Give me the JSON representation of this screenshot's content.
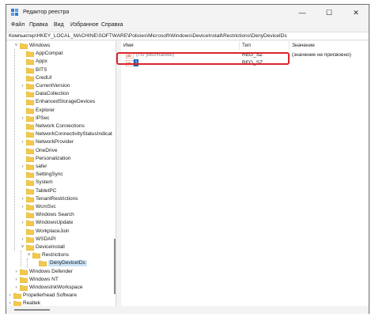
{
  "window": {
    "title": "Редактор реестра",
    "controls": {
      "minimize": "—",
      "maximize": "☐",
      "close": "✕"
    }
  },
  "menu": [
    "Файл",
    "Правка",
    "Вид",
    "Избранное",
    "Справка"
  ],
  "address": "Компьютер\\HKEY_LOCAL_MACHINE\\SOFTWARE\\Policies\\Microsoft\\Windows\\DeviceInstall\\Restrictions\\DenyDeviceIDs",
  "tree": [
    {
      "label": "Windows",
      "level": 1,
      "expander": "˅",
      "open": true
    },
    {
      "label": "AppCompat",
      "level": 2
    },
    {
      "label": "Appx",
      "level": 2
    },
    {
      "label": "BITS",
      "level": 2
    },
    {
      "label": "CredUI",
      "level": 2
    },
    {
      "label": "CurrentVersion",
      "level": 2,
      "expander": "›"
    },
    {
      "label": "DataCollection",
      "level": 2
    },
    {
      "label": "EnhancedStorageDevices",
      "level": 2
    },
    {
      "label": "Explorer",
      "level": 2
    },
    {
      "label": "IPSec",
      "level": 2,
      "expander": "›"
    },
    {
      "label": "Network Connections",
      "level": 2
    },
    {
      "label": "NetworkConnectivityStatusIndicat",
      "level": 2
    },
    {
      "label": "NetworkProvider",
      "level": 2,
      "expander": "›"
    },
    {
      "label": "OneDrive",
      "level": 2
    },
    {
      "label": "Personalization",
      "level": 2
    },
    {
      "label": "safer",
      "level": 2,
      "expander": "›"
    },
    {
      "label": "SettingSync",
      "level": 2
    },
    {
      "label": "System",
      "level": 2
    },
    {
      "label": "TabletPC",
      "level": 2
    },
    {
      "label": "TenantRestrictions",
      "level": 2,
      "expander": "›"
    },
    {
      "label": "WcmSvc",
      "level": 2,
      "expander": "›"
    },
    {
      "label": "Windows Search",
      "level": 2
    },
    {
      "label": "WindowsUpdate",
      "level": 2,
      "expander": "›"
    },
    {
      "label": "WorkplaceJoin",
      "level": 2
    },
    {
      "label": "WSDAPI",
      "level": 2,
      "expander": "›"
    },
    {
      "label": "DeviceInstall",
      "level": 2,
      "expander": "˅",
      "open": true
    },
    {
      "label": "Restrictions",
      "level": 3,
      "expander": "˅",
      "open": true
    },
    {
      "label": "DenyDeviceIDs",
      "level": 4,
      "selected": true
    },
    {
      "label": "Windows Defender",
      "level": 1,
      "expander": "›"
    },
    {
      "label": "Windows NT",
      "level": 1,
      "expander": "›"
    },
    {
      "label": "WindowsInkWorkspace",
      "level": 1,
      "expander": "›"
    },
    {
      "label": "Propellerhead Software",
      "level": 0,
      "expander": "›"
    },
    {
      "label": "Realtek",
      "level": 0,
      "expander": "›"
    },
    {
      "label": "RegisteredApplications",
      "level": 0
    },
    {
      "label": "Respawn",
      "level": 0,
      "expander": "›"
    },
    {
      "label": "Rockstar Games",
      "level": 0,
      "expander": "›"
    }
  ],
  "columns": {
    "name": "Имя",
    "type": "Тип",
    "value": "Значение"
  },
  "values": [
    {
      "name": "(По умолчанию)",
      "type": "REG_SZ",
      "value": "(значение не присвоено)",
      "icon": "ab-string-icon"
    },
    {
      "name": "1",
      "type": "REG_SZ",
      "value": "",
      "icon": "ab-string-icon",
      "editing": true
    }
  ],
  "colors": {
    "highlight": "#d9252b",
    "selection": "#cce4f7",
    "folder": "#f2c94c",
    "edit": "#1f5fb4"
  }
}
